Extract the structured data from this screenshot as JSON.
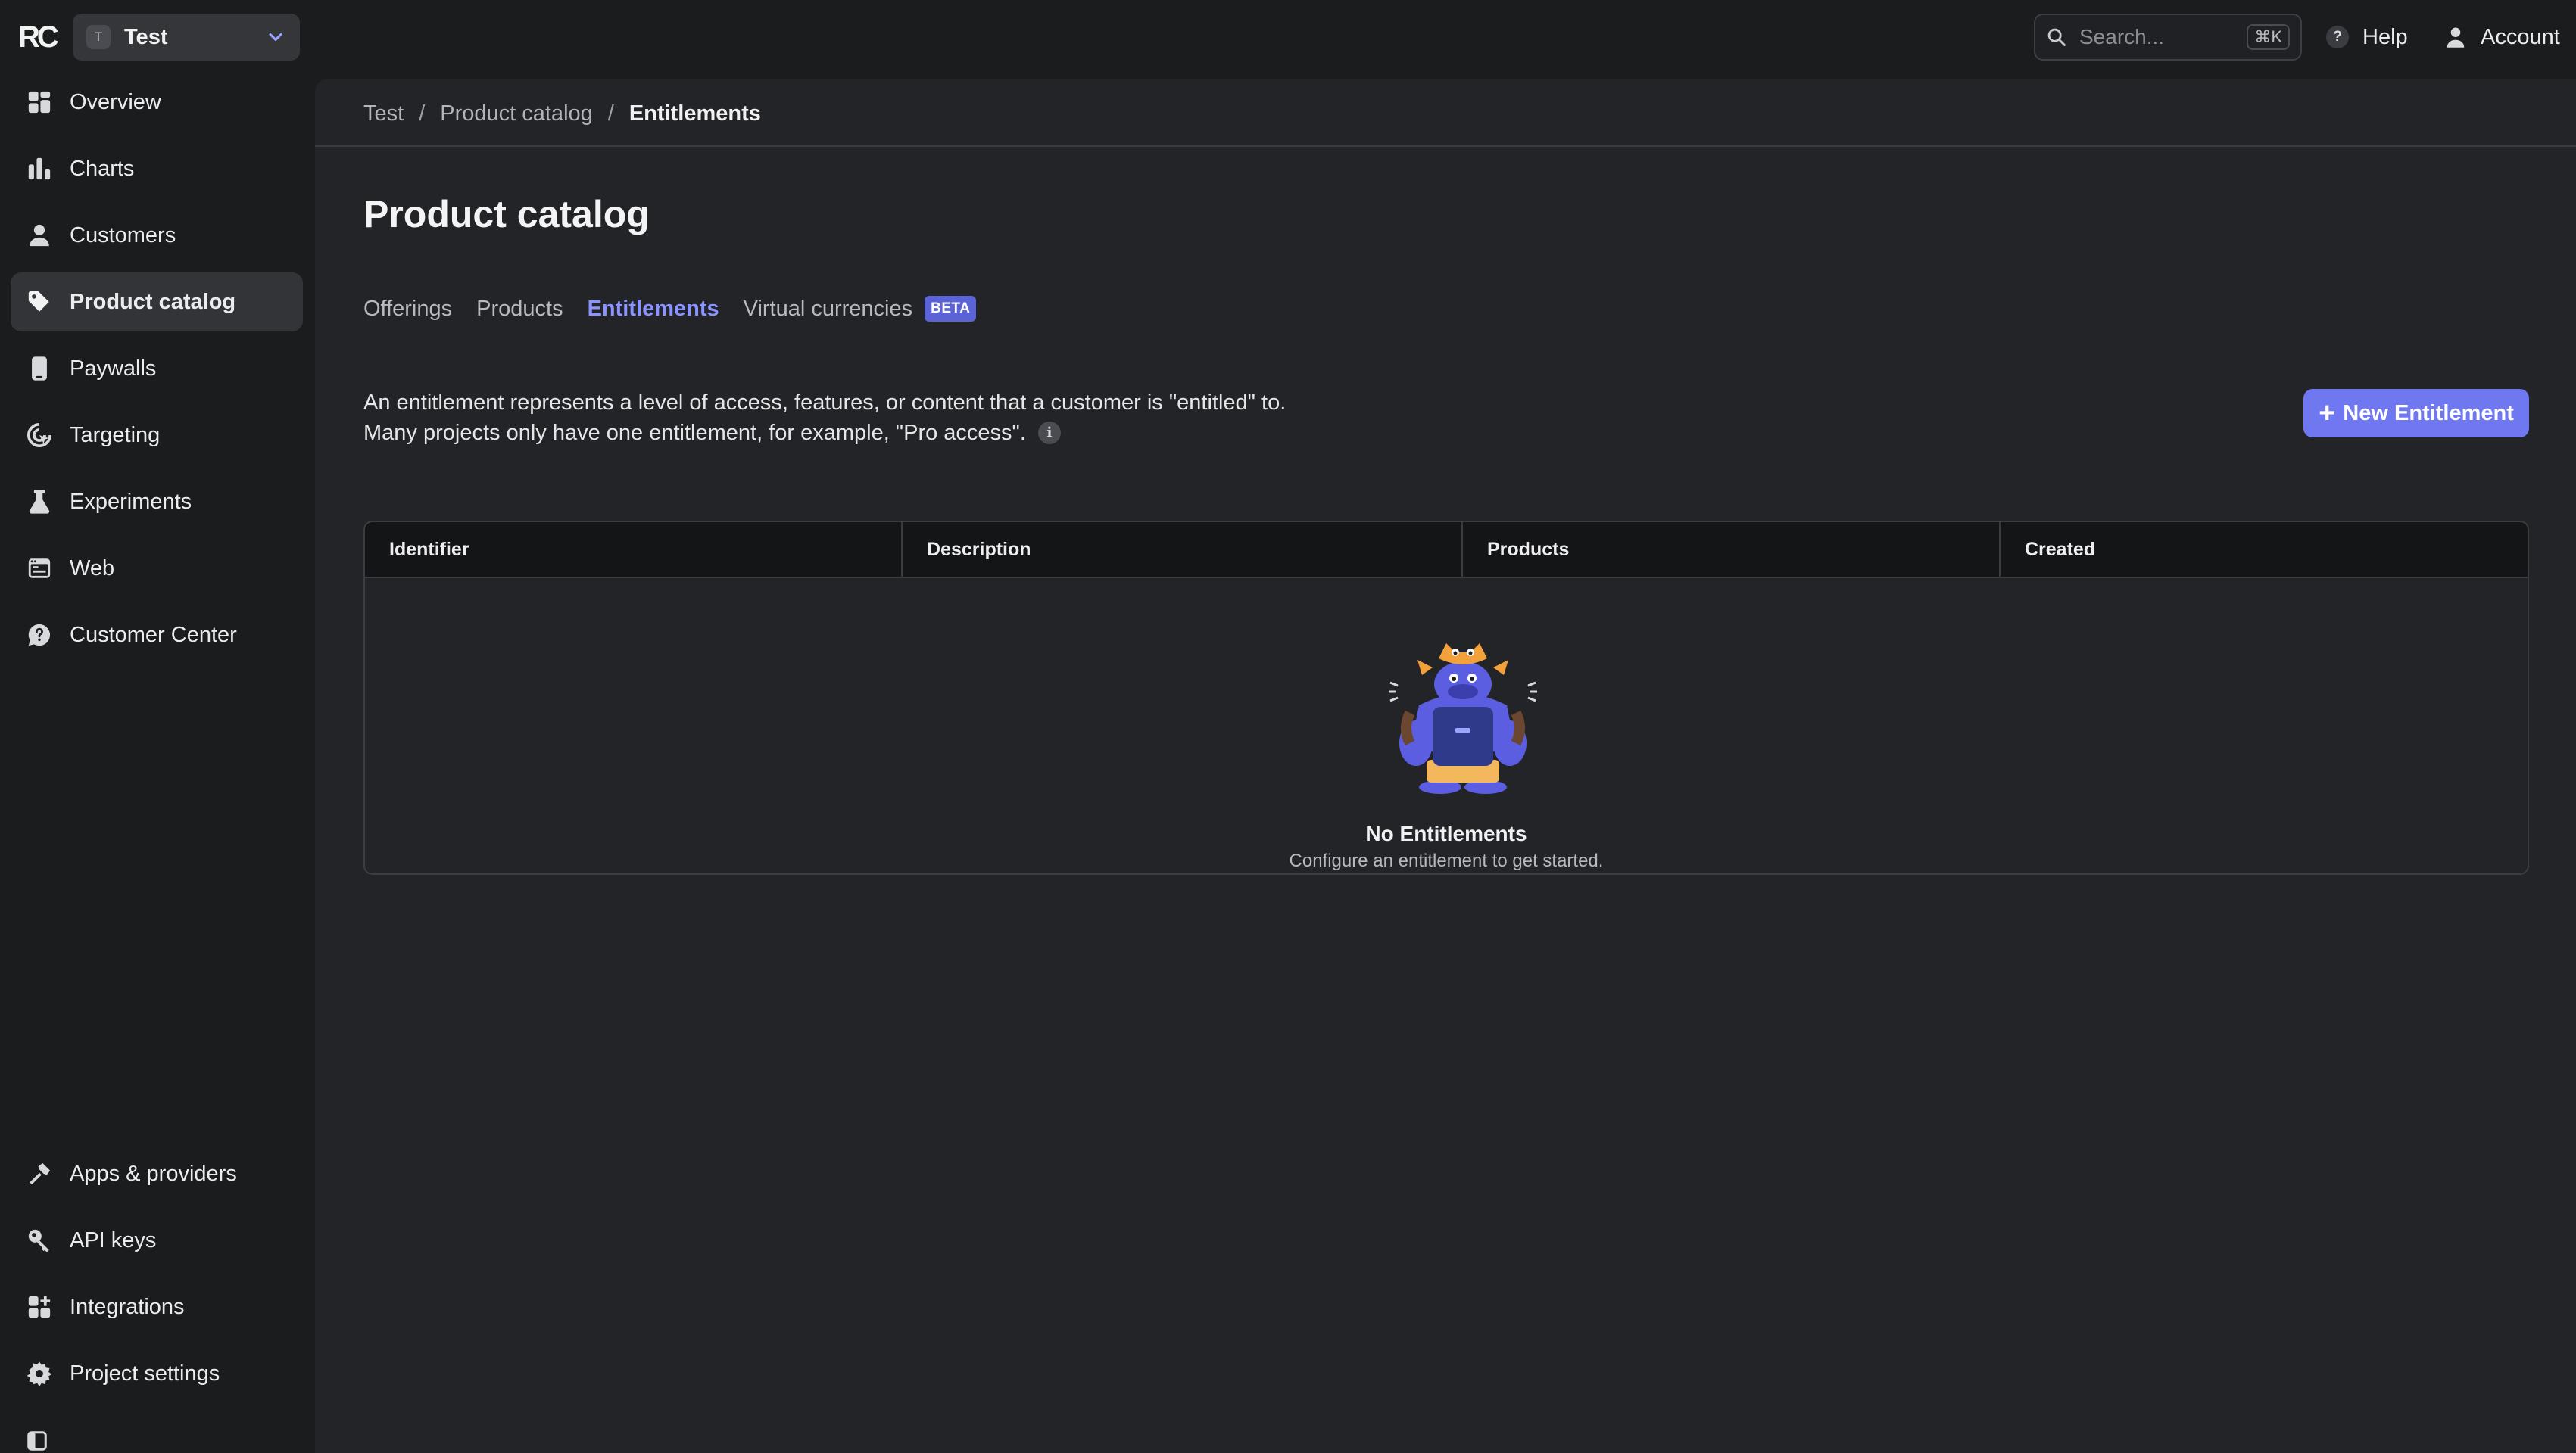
{
  "app": {
    "logo": "RC"
  },
  "project": {
    "avatar_letter": "T",
    "name": "Test"
  },
  "sidebar": {
    "items": [
      {
        "label": "Overview",
        "icon": "grid-icon"
      },
      {
        "label": "Charts",
        "icon": "bar-chart-icon"
      },
      {
        "label": "Customers",
        "icon": "user-icon"
      },
      {
        "label": "Product catalog",
        "icon": "tag-icon",
        "active": true
      },
      {
        "label": "Paywalls",
        "icon": "phone-icon"
      },
      {
        "label": "Targeting",
        "icon": "target-icon"
      },
      {
        "label": "Experiments",
        "icon": "flask-icon"
      },
      {
        "label": "Web",
        "icon": "browser-icon"
      },
      {
        "label": "Customer Center",
        "icon": "support-icon"
      }
    ],
    "bottom_items": [
      {
        "label": "Apps & providers",
        "icon": "hammer-icon"
      },
      {
        "label": "API keys",
        "icon": "key-icon"
      },
      {
        "label": "Integrations",
        "icon": "integrations-icon"
      },
      {
        "label": "Project settings",
        "icon": "gear-icon"
      }
    ]
  },
  "topbar": {
    "search_placeholder": "Search...",
    "search_shortcut": "⌘K",
    "help_label": "Help",
    "account_label": "Account"
  },
  "breadcrumb": {
    "items": [
      "Test",
      "Product catalog"
    ],
    "current": "Entitlements",
    "separator": "/"
  },
  "page": {
    "title": "Product catalog",
    "tabs": [
      {
        "label": "Offerings"
      },
      {
        "label": "Products"
      },
      {
        "label": "Entitlements",
        "active": true
      },
      {
        "label": "Virtual currencies",
        "badge": "BETA"
      }
    ],
    "description_line1": "An entitlement represents a level of access, features, or content that a customer is \"entitled\" to.",
    "description_line2": "Many projects only have one entitlement, for example, \"Pro access\".",
    "new_button_label": "New Entitlement"
  },
  "table": {
    "columns": [
      "Identifier",
      "Description",
      "Products",
      "Created"
    ],
    "rows": [],
    "empty_title": "No Entitlements",
    "empty_subtitle": "Configure an entitlement to get started."
  },
  "colors": {
    "accent": "#8a93ff",
    "button": "#6f78f0",
    "background": "#1b1c1e",
    "panel": "#232427"
  }
}
